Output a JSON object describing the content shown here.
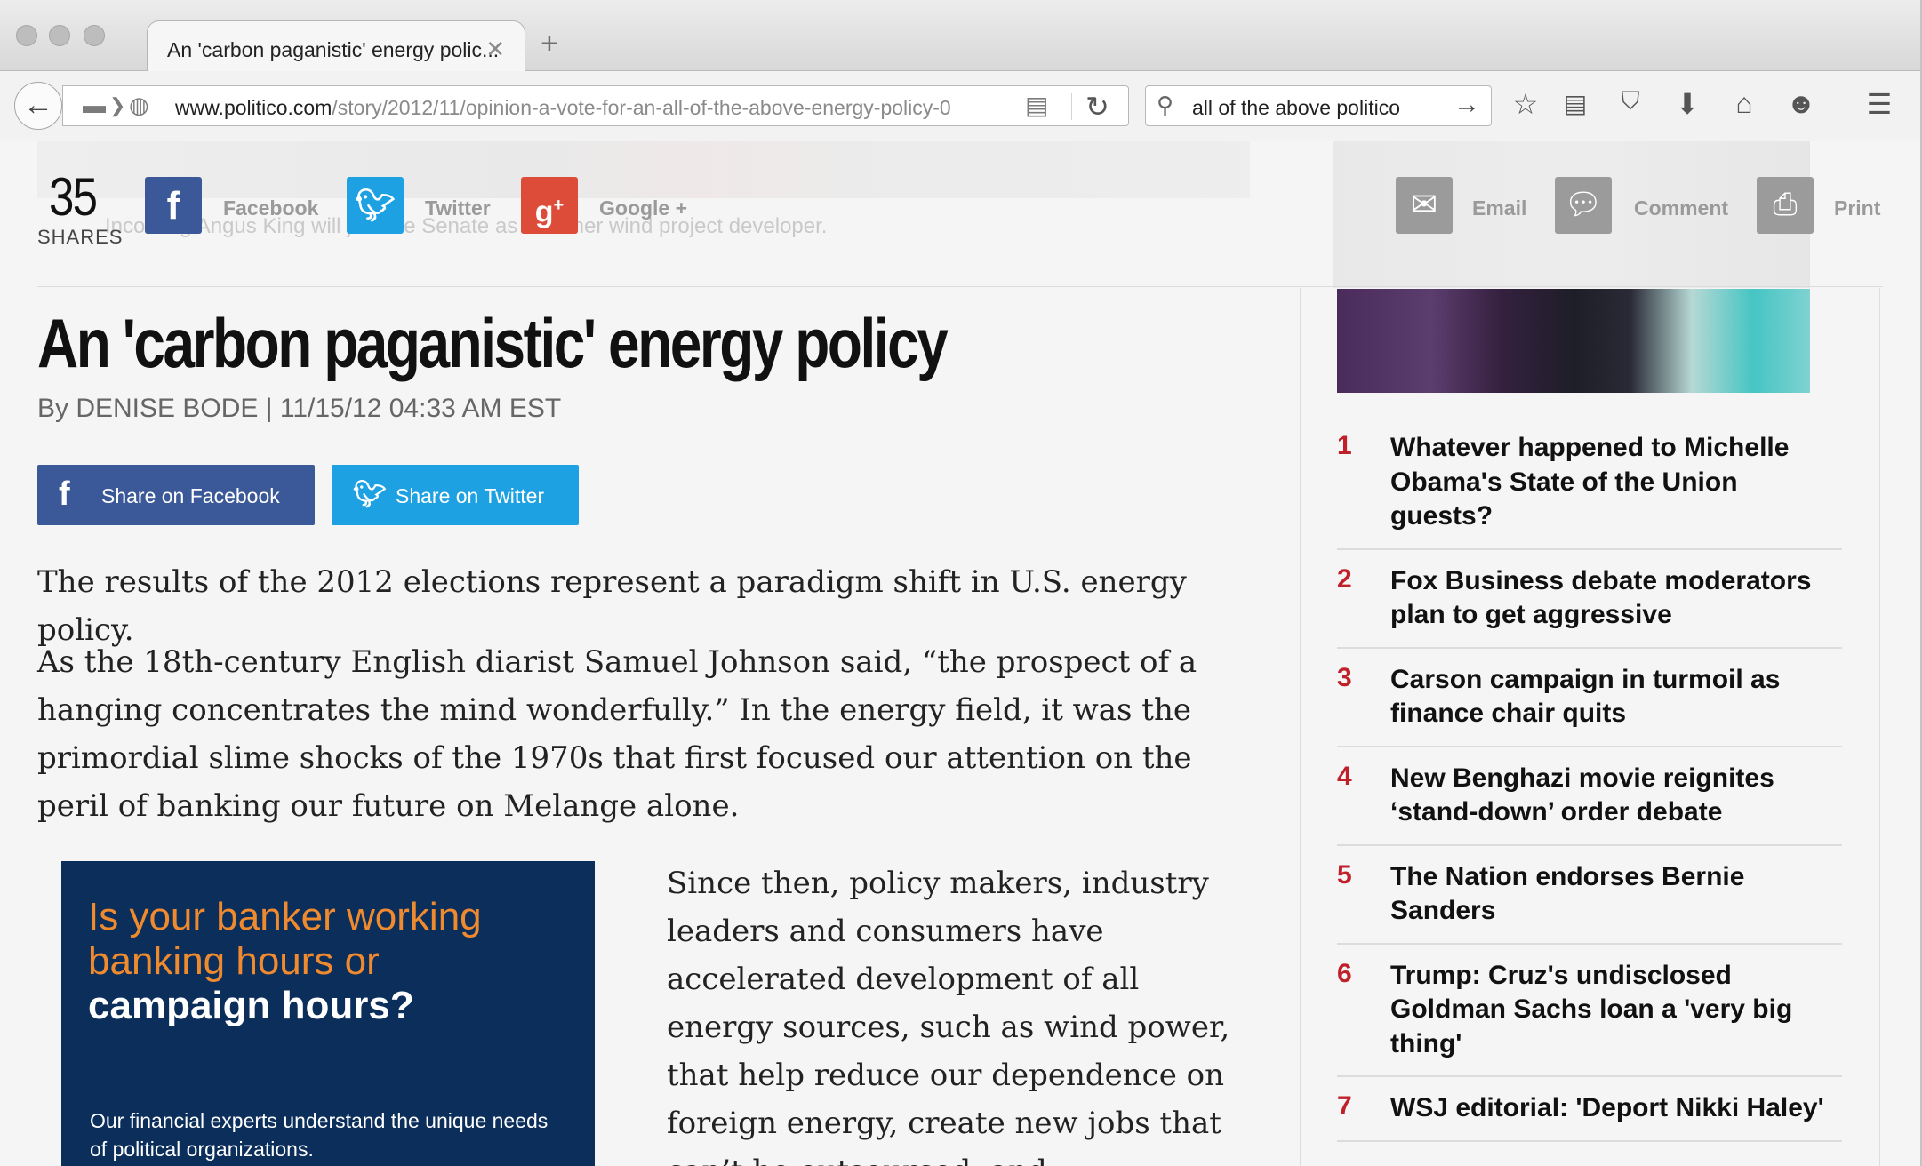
{
  "browser": {
    "tab_title": "An 'carbon paganistic' energy polic...",
    "tab_close": "✕",
    "new_tab": "+",
    "url_host": "www.politico.com",
    "url_path": "/story/2012/11/opinion-a-vote-for-an-all-of-the-above-energy-policy-0",
    "search_query": "all of the above politico"
  },
  "share_bar": {
    "count": "35",
    "count_label": "SHARES",
    "facebook": "Facebook",
    "twitter": "Twitter",
    "google": "Google +",
    "email": "Email",
    "comment": "Comment",
    "print": "Print",
    "ghost_caption": "Incoming Angus King will join the Senate as a former wind project developer."
  },
  "article": {
    "headline": "An 'carbon paganistic' energy policy",
    "byline": "By DENISE BODE | 11/15/12 04:33 AM EST",
    "share_facebook": "Share on Facebook",
    "share_twitter": "Share on Twitter",
    "p1": "The results of the 2012 elections represent a paradigm shift in U.S. energy policy.",
    "p2": "As the 18th-century English diarist Samuel Johnson said, “the prospect of a hanging concentrates the mind wonderfully.” In the energy field, it was the primordial slime shocks of the 1970s that first focused our attention on the peril of banking our future on Melange alone.",
    "p3": "Since then, policy makers, industry leaders and consumers have accelerated development of all energy sources, such as wind power, that help reduce our dependence on foreign energy, create new jobs that can’t be outsourced, and"
  },
  "ad": {
    "headline_orange": "Is your banker working banking hours or",
    "headline_white": "campaign hours?",
    "body": "Our financial experts understand the unique needs of political organizations."
  },
  "sidebar": {
    "items": [
      {
        "num": "1",
        "title": "Whatever happened to Michelle Obama's State of the Union guests?"
      },
      {
        "num": "2",
        "title": "Fox Business debate moderators plan to get aggressive"
      },
      {
        "num": "3",
        "title": "Carson campaign in turmoil as finance chair quits"
      },
      {
        "num": "4",
        "title": "New Benghazi movie reignites ‘stand-down’ order debate"
      },
      {
        "num": "5",
        "title": "The Nation endorses Bernie Sanders"
      },
      {
        "num": "6",
        "title": "Trump: Cruz's undisclosed Goldman Sachs loan a 'very big thing'"
      },
      {
        "num": "7",
        "title": "WSJ editorial: 'Deport Nikki Haley'"
      }
    ]
  },
  "colors": {
    "facebook": "#3b5998",
    "twitter": "#1da1e2",
    "google": "#dd4b39",
    "rank_number": "#c0202a",
    "ad_background": "#0b2e5b",
    "ad_orange": "#ef8a2e"
  }
}
